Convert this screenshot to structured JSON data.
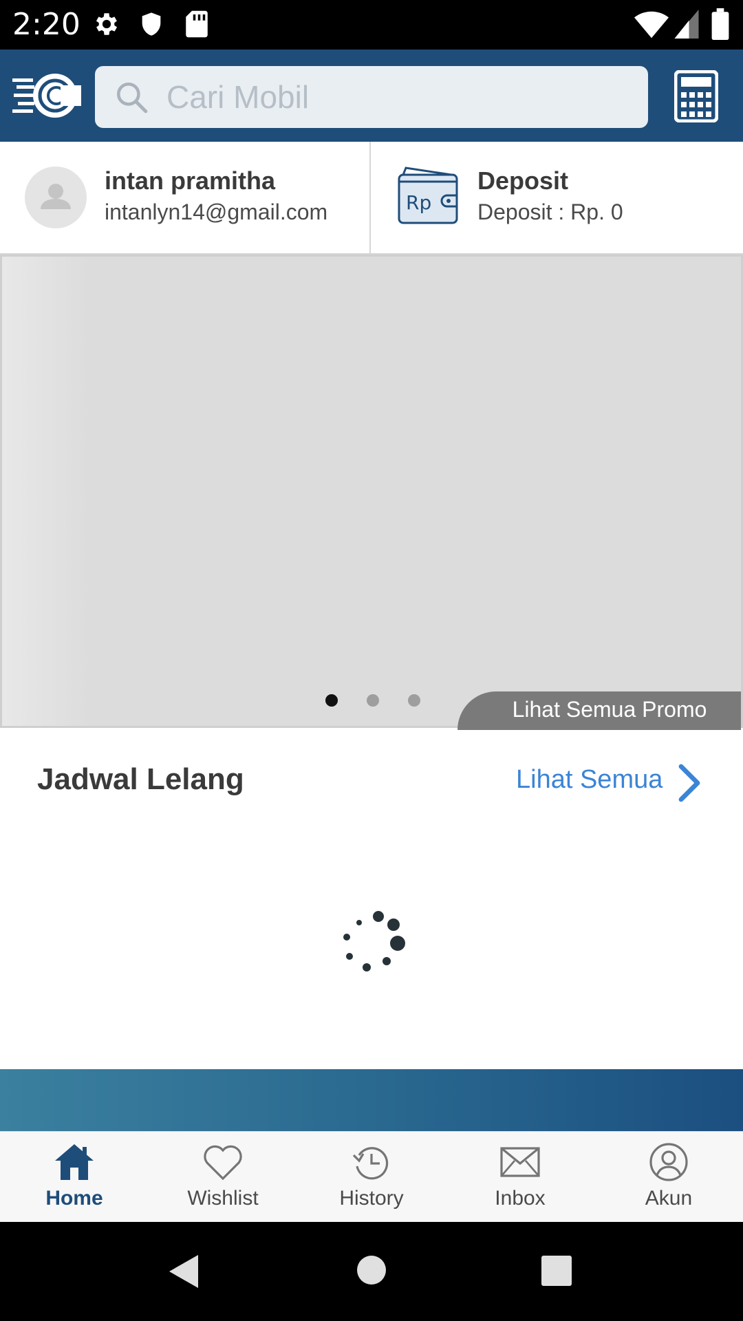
{
  "status_bar": {
    "time": "2:20",
    "icons": [
      "settings-icon",
      "shield-icon",
      "sd-card-icon",
      "wifi-icon",
      "signal-icon",
      "battery-icon"
    ]
  },
  "header": {
    "logo": "app-logo",
    "search": {
      "placeholder": "Cari Mobil",
      "value": ""
    },
    "calculator_icon": "calculator-icon",
    "background_color": "#1f4d7a"
  },
  "account": {
    "name": "intan pramitha",
    "email": "intanlyn14@gmail.com",
    "deposit_title": "Deposit",
    "deposit_value": "Deposit : Rp. 0",
    "wallet_icon": "wallet-rp-icon"
  },
  "banner": {
    "pages": 3,
    "active_page": 1,
    "promo_link": "Lihat Semua Promo"
  },
  "auction_section": {
    "title": "Jadwal Lelang",
    "see_all": "Lihat Semua",
    "loading": true
  },
  "bottom_nav": {
    "items": [
      {
        "label": "Home",
        "icon": "home-icon",
        "active": true
      },
      {
        "label": "Wishlist",
        "icon": "heart-icon",
        "active": false
      },
      {
        "label": "History",
        "icon": "history-icon",
        "active": false
      },
      {
        "label": "Inbox",
        "icon": "mail-icon",
        "active": false
      },
      {
        "label": "Akun",
        "icon": "account-icon",
        "active": false
      }
    ]
  },
  "colors": {
    "brand_primary": "#1f4d7a",
    "link_blue": "#3b84d6",
    "active_nav": "#1f4d7a"
  }
}
